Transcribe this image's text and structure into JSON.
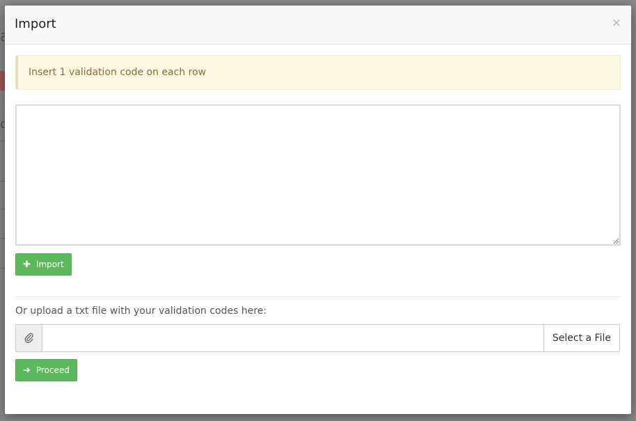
{
  "modal": {
    "title": "Import",
    "close_icon": "close-icon",
    "alert_text": "Insert 1 validation code on each row",
    "textarea_value": "",
    "import_button": {
      "icon": "plus-icon",
      "label": "Import"
    },
    "upload_label": "Or upload a txt file with your validation codes here:",
    "upload_addon_icon": "paperclip-icon",
    "upload_input_value": "",
    "select_file_label": "Select a File",
    "proceed_button": {
      "icon": "arrow-right-icon",
      "label": "Proceed"
    }
  },
  "colors": {
    "success": "#5cb85c",
    "warning_bg": "#fcf8e3",
    "warning_text": "#8a6d3b"
  }
}
